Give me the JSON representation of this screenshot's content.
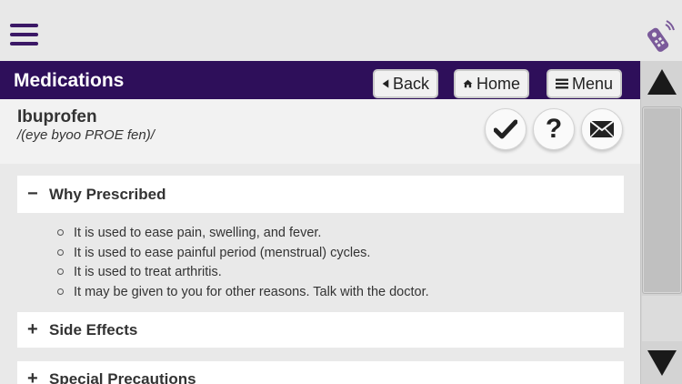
{
  "app": {
    "menu_icon": "hamburger-icon",
    "remote_icon": "remote-control-icon",
    "brand_color": "#2e0f5a"
  },
  "header": {
    "title": "Medications",
    "back_label": "Back",
    "home_label": "Home",
    "menu_label": "Menu",
    "back_icon": "triangle-left-icon",
    "home_icon": "house-icon",
    "menu_icon": "list-icon"
  },
  "drug": {
    "name": "Ibuprofen",
    "pronunciation": "/(eye byoo PROE fen)/",
    "actions": [
      "check-icon",
      "question-icon",
      "envelope-icon"
    ],
    "help_glyph": "?"
  },
  "sections": {
    "why_prescribed": {
      "label": "Why Prescribed",
      "state_symbol": "−",
      "expanded": true,
      "items": [
        "It is used to ease pain, swelling, and fever.",
        "It is used to ease painful period (menstrual) cycles.",
        "It is used to treat arthritis.",
        "It may be given to you for other reasons. Talk with the doctor."
      ]
    },
    "side_effects": {
      "label": "Side Effects",
      "state_symbol": "+",
      "expanded": false
    },
    "special_precautions": {
      "label": "Special Precautions",
      "state_symbol": "+",
      "expanded": false
    }
  },
  "scrollbar": {
    "up_icon": "triangle-up-icon",
    "down_icon": "triangle-down-icon"
  }
}
